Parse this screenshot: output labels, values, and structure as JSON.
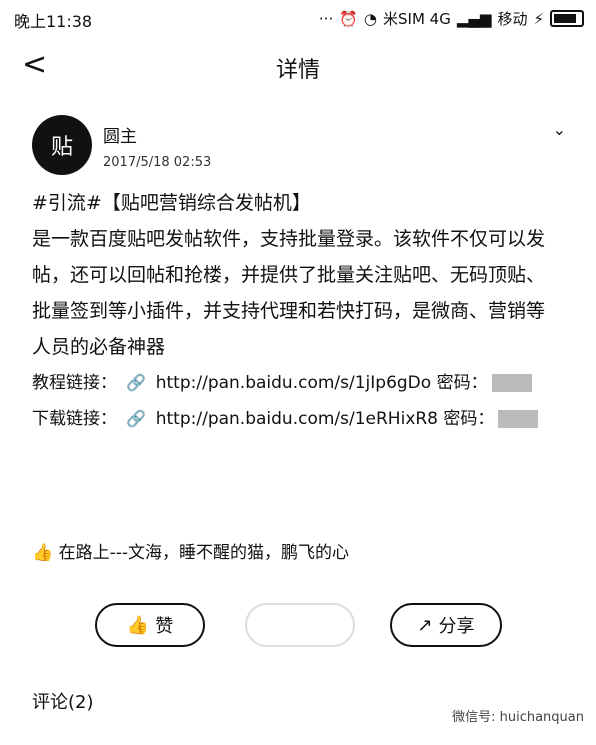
{
  "status": {
    "time": "晚上11:38",
    "carrier": "米SIM 4G",
    "operator": "移动"
  },
  "header": {
    "title": "详情"
  },
  "post": {
    "author": "圆主",
    "date": "2017/5/18 02:53",
    "line1": "#引流#【贴吧营销综合发帖机】",
    "body": "是一款百度贴吧发帖软件，支持批量登录。该软件不仅可以发帖，还可以回帖和抢楼，并提供了批量关注贴吧、无码顶贴、批量签到等小插件，并支持代理和若快打码，是微商、营销等人员的必备神器",
    "tutorial_label": "教程链接：",
    "tutorial_url": "http://pan.baidu.com/s/1jIp6gDo",
    "download_label": "下载链接：",
    "download_url": "http://pan.baidu.com/s/1eRHixR8",
    "pwd_label": "密码："
  },
  "likes": {
    "text": "在路上---文海，睡不醒的猫，鹏飞的心"
  },
  "buttons": {
    "like": "赞",
    "share": "分享"
  },
  "comments": {
    "label": "评论(2)"
  },
  "watermark": {
    "text": "微信号: huichanquan"
  }
}
